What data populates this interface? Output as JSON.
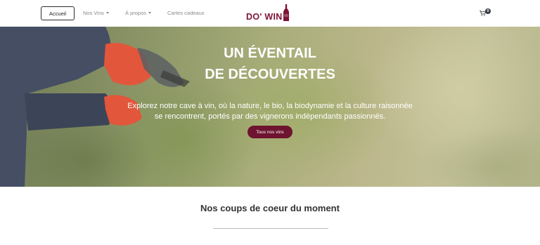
{
  "nav": {
    "home_label": "Accueil",
    "items": [
      {
        "label": "Nos Vins",
        "has_caret": true
      },
      {
        "label": "À propos",
        "has_caret": true
      },
      {
        "label": "Cartes cadeaux",
        "has_caret": false
      }
    ],
    "logo_text": "DO' WIN",
    "cart_count": "0"
  },
  "hero": {
    "title_line1": "UN ÉVENTAIL",
    "title_line2": "DE DÉCOUVERTES",
    "subtitle_line1": "Explorez notre cave à vin, où la nature, le bio, la biodynamie et la culture raisonnée",
    "subtitle_line2": "se rencontrent, portés par des vignerons indépendants passionnés.",
    "button_label": "Tous nos vins"
  },
  "section": {
    "title": "Nos coups de coeur du moment"
  },
  "colors": {
    "brand": "#7d1535",
    "button": "#6e1330",
    "glove": "#e2563b",
    "sleeve": "#454e63"
  },
  "icons": [
    "bottle-icon",
    "cart-icon",
    "chevron-down-icon"
  ]
}
